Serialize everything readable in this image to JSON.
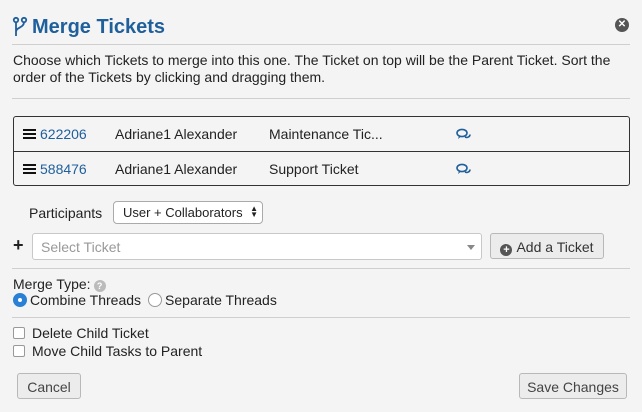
{
  "dialog": {
    "title": "Merge Tickets",
    "title_icon": "branch-icon",
    "close_icon": "close-icon",
    "description": "Choose which Tickets to merge into this one. The Ticket on top will be the Parent Ticket. Sort the order of the Tickets by clicking and dragging them."
  },
  "tickets": [
    {
      "id": "622206",
      "name": "Adriane1 Alexander",
      "subject": "Maintenance Tic..."
    },
    {
      "id": "588476",
      "name": "Adriane1 Alexander",
      "subject": "Support Ticket"
    }
  ],
  "participants": {
    "label": "Participants",
    "value": "User + Collaborators"
  },
  "add_ticket": {
    "plus": "+",
    "placeholder": "Select Ticket",
    "button": "Add a Ticket"
  },
  "merge_type": {
    "label": "Merge Type:",
    "help": "?",
    "options": [
      {
        "label": "Combine Threads",
        "selected": true
      },
      {
        "label": "Separate Threads",
        "selected": false
      }
    ]
  },
  "options": {
    "delete_child": "Delete Child Ticket",
    "move_tasks": "Move Child Tasks to Parent"
  },
  "footer": {
    "cancel": "Cancel",
    "save": "Save Changes"
  },
  "colors": {
    "accent": "#1f5f9c",
    "radio_selected": "#2a7fd6"
  }
}
